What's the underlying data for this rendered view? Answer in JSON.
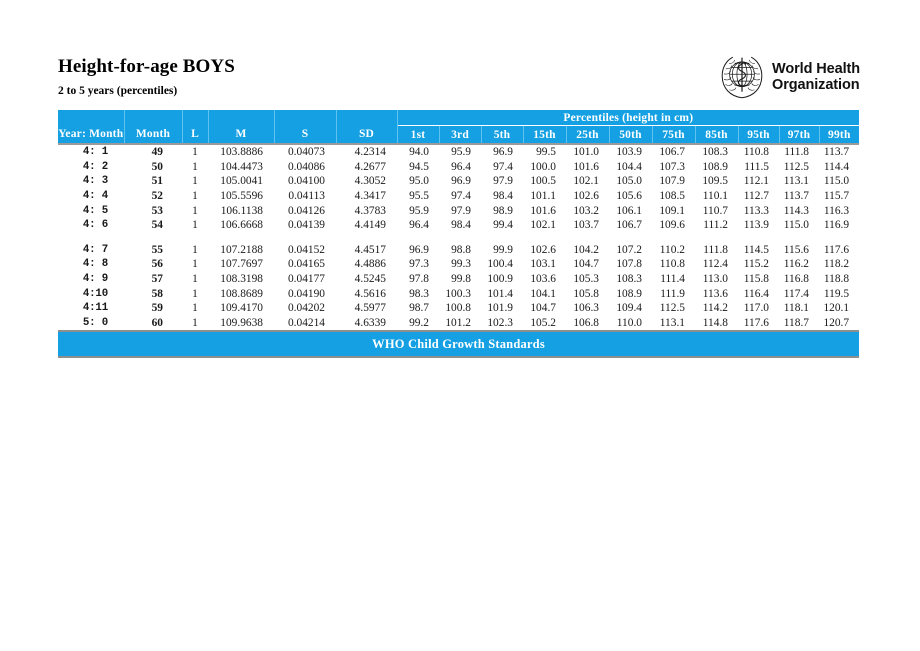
{
  "document": {
    "title": "Height-for-age BOYS",
    "subtitle": "2 to 5 years (percentiles)"
  },
  "logo": {
    "line1": "World Health",
    "line2": "Organization",
    "emblem_name": "who-emblem"
  },
  "table": {
    "group_header": "Percentiles (height in cm)",
    "columns": [
      "Year: Month",
      "Month",
      "L",
      "M",
      "S",
      "SD",
      "1st",
      "3rd",
      "5th",
      "15th",
      "25th",
      "50th",
      "75th",
      "85th",
      "95th",
      "97th",
      "99th"
    ],
    "rows": [
      [
        "4: 1",
        "49",
        "1",
        "103.8886",
        "0.04073",
        "4.2314",
        "94.0",
        "95.9",
        "96.9",
        "99.5",
        "101.0",
        "103.9",
        "106.7",
        "108.3",
        "110.8",
        "111.8",
        "113.7"
      ],
      [
        "4: 2",
        "50",
        "1",
        "104.4473",
        "0.04086",
        "4.2677",
        "94.5",
        "96.4",
        "97.4",
        "100.0",
        "101.6",
        "104.4",
        "107.3",
        "108.9",
        "111.5",
        "112.5",
        "114.4"
      ],
      [
        "4: 3",
        "51",
        "1",
        "105.0041",
        "0.04100",
        "4.3052",
        "95.0",
        "96.9",
        "97.9",
        "100.5",
        "102.1",
        "105.0",
        "107.9",
        "109.5",
        "112.1",
        "113.1",
        "115.0"
      ],
      [
        "4: 4",
        "52",
        "1",
        "105.5596",
        "0.04113",
        "4.3417",
        "95.5",
        "97.4",
        "98.4",
        "101.1",
        "102.6",
        "105.6",
        "108.5",
        "110.1",
        "112.7",
        "113.7",
        "115.7"
      ],
      [
        "4: 5",
        "53",
        "1",
        "106.1138",
        "0.04126",
        "4.3783",
        "95.9",
        "97.9",
        "98.9",
        "101.6",
        "103.2",
        "106.1",
        "109.1",
        "110.7",
        "113.3",
        "114.3",
        "116.3"
      ],
      [
        "4: 6",
        "54",
        "1",
        "106.6668",
        "0.04139",
        "4.4149",
        "96.4",
        "98.4",
        "99.4",
        "102.1",
        "103.7",
        "106.7",
        "109.6",
        "111.2",
        "113.9",
        "115.0",
        "116.9"
      ],
      [
        "4: 7",
        "55",
        "1",
        "107.2188",
        "0.04152",
        "4.4517",
        "96.9",
        "98.8",
        "99.9",
        "102.6",
        "104.2",
        "107.2",
        "110.2",
        "111.8",
        "114.5",
        "115.6",
        "117.6"
      ],
      [
        "4: 8",
        "56",
        "1",
        "107.7697",
        "0.04165",
        "4.4886",
        "97.3",
        "99.3",
        "100.4",
        "103.1",
        "104.7",
        "107.8",
        "110.8",
        "112.4",
        "115.2",
        "116.2",
        "118.2"
      ],
      [
        "4: 9",
        "57",
        "1",
        "108.3198",
        "0.04177",
        "4.5245",
        "97.8",
        "99.8",
        "100.9",
        "103.6",
        "105.3",
        "108.3",
        "111.4",
        "113.0",
        "115.8",
        "116.8",
        "118.8"
      ],
      [
        "4:10",
        "58",
        "1",
        "108.8689",
        "0.04190",
        "4.5616",
        "98.3",
        "100.3",
        "101.4",
        "104.1",
        "105.8",
        "108.9",
        "111.9",
        "113.6",
        "116.4",
        "117.4",
        "119.5"
      ],
      [
        "4:11",
        "59",
        "1",
        "109.4170",
        "0.04202",
        "4.5977",
        "98.7",
        "100.8",
        "101.9",
        "104.7",
        "106.3",
        "109.4",
        "112.5",
        "114.2",
        "117.0",
        "118.1",
        "120.1"
      ],
      [
        "5: 0",
        "60",
        "1",
        "109.9638",
        "0.04214",
        "4.6339",
        "99.2",
        "101.2",
        "102.3",
        "105.2",
        "106.8",
        "110.0",
        "113.1",
        "114.8",
        "117.6",
        "118.7",
        "120.7"
      ]
    ],
    "spacer_after_row_index": 5
  },
  "footer": {
    "banner": "WHO Child Growth Standards"
  },
  "colors": {
    "banner_blue": "#14A0E2",
    "rule_gray": "#9a9a9a",
    "text": "#1a1a1a"
  }
}
